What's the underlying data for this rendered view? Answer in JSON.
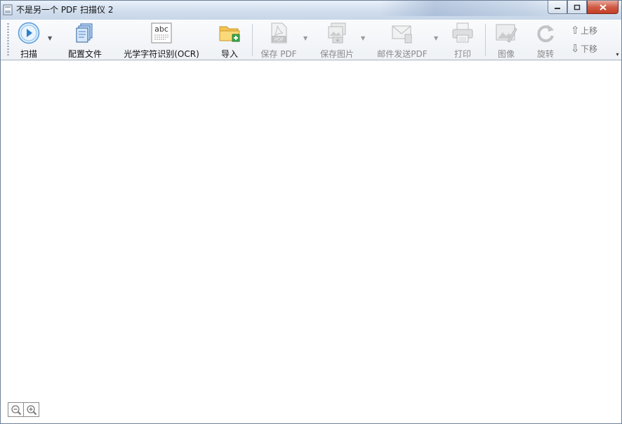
{
  "window": {
    "title": "不是另一个 PDF 扫描仪 2"
  },
  "controls": {
    "minimize_icon": "minimize-icon",
    "maximize_icon": "maximize-icon",
    "close_icon": "close-icon"
  },
  "toolbar": {
    "scan": {
      "label": "扫描",
      "icon": "scan-play-icon",
      "enabled": true
    },
    "profiles": {
      "label": "配置文件",
      "icon": "profiles-icon",
      "enabled": true
    },
    "ocr": {
      "label": "光学字符识别(OCR)",
      "icon": "ocr-icon",
      "icon_text": "abc",
      "enabled": true
    },
    "import": {
      "label": "导入",
      "icon": "folder-import-icon",
      "enabled": true
    },
    "save_pdf": {
      "label": "保存 PDF",
      "icon": "pdf-icon",
      "icon_text": "PDF",
      "enabled": false
    },
    "save_image": {
      "label": "保存图片",
      "icon": "save-image-icon",
      "enabled": false
    },
    "email_pdf": {
      "label": "邮件发送PDF",
      "icon": "email-icon",
      "enabled": false
    },
    "print": {
      "label": "打印",
      "icon": "printer-icon",
      "enabled": false
    },
    "image": {
      "label": "图像",
      "icon": "image-edit-icon",
      "enabled": false
    },
    "rotate": {
      "label": "旋转",
      "icon": "rotate-icon",
      "enabled": false
    },
    "move_up": {
      "label": "上移",
      "icon": "arrow-up-icon",
      "enabled": false
    },
    "move_down": {
      "label": "下移",
      "icon": "arrow-down-icon",
      "enabled": false
    }
  },
  "zoom": {
    "zoom_out_icon": "zoom-out-icon",
    "zoom_in_icon": "zoom-in-icon"
  }
}
